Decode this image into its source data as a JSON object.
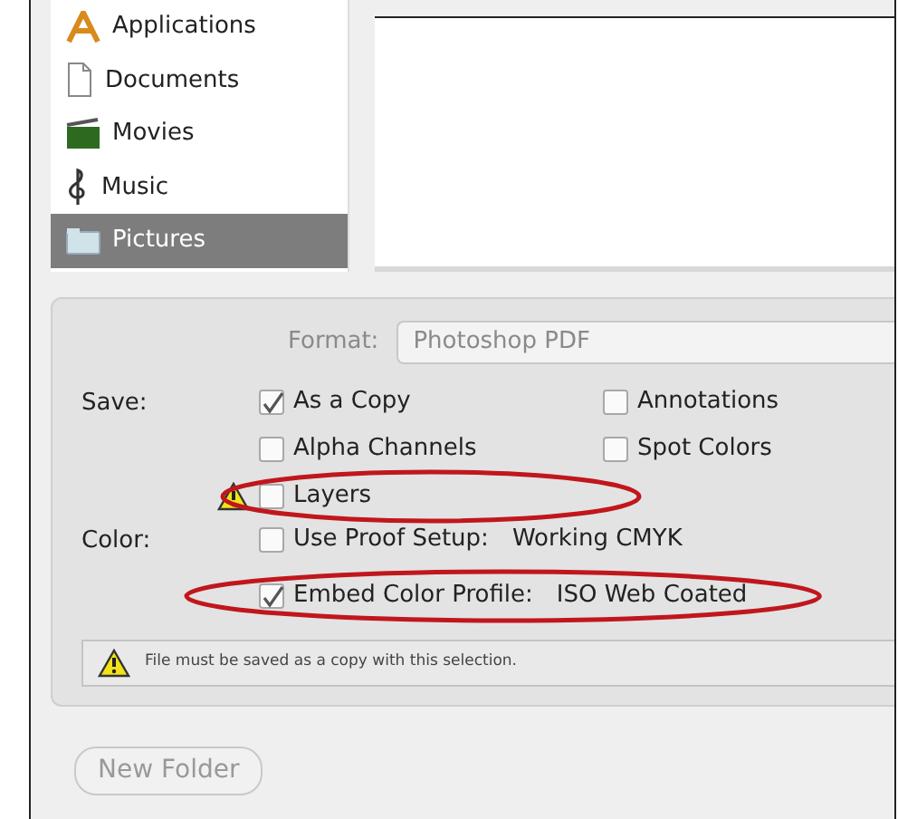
{
  "sidebar": {
    "items": [
      {
        "label": "Applications",
        "kind": "apps",
        "selected": false
      },
      {
        "label": "Documents",
        "kind": "document",
        "selected": false
      },
      {
        "label": "Movies",
        "kind": "movies",
        "selected": false
      },
      {
        "label": "Music",
        "kind": "music",
        "selected": false
      },
      {
        "label": "Pictures",
        "kind": "pictures",
        "selected": true
      }
    ]
  },
  "format": {
    "label": "Format:",
    "value": "Photoshop PDF",
    "disabled": true
  },
  "save": {
    "label": "Save:",
    "columns": [
      [
        {
          "label": "As a Copy",
          "checked": true,
          "warning": false
        },
        {
          "label": "Alpha Channels",
          "checked": false,
          "warning": false
        },
        {
          "label": "Layers",
          "checked": false,
          "warning": true
        }
      ],
      [
        {
          "label": "Annotations",
          "checked": false,
          "warning": false
        },
        {
          "label": "Spot Colors",
          "checked": false,
          "warning": false
        }
      ]
    ]
  },
  "color": {
    "label": "Color:",
    "options": [
      {
        "label": "Use Proof Setup:",
        "value": "Working CMYK",
        "checked": false
      },
      {
        "label": "Embed Color Profile:",
        "value": "ISO Web Coated",
        "checked": true
      }
    ]
  },
  "warning": {
    "text": "File must be saved as a copy with this selection."
  },
  "buttons": [
    {
      "label": "New Folder",
      "disabled": true
    }
  ]
}
